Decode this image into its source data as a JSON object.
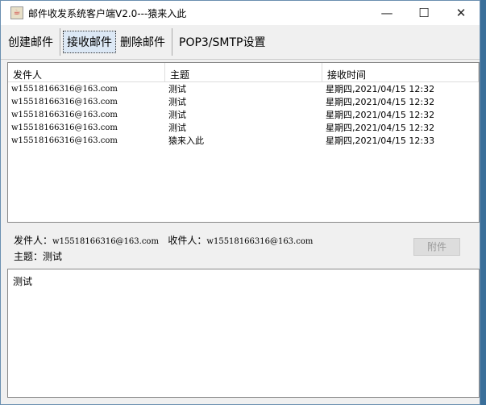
{
  "window": {
    "title": "邮件收发系统客户端V2.0---猿来入此",
    "minimize": "—",
    "maximize": "☐",
    "close": "✕"
  },
  "toolbar": [
    "创建邮件",
    "接收邮件",
    "删除邮件",
    "POP3/SMTP设置"
  ],
  "table": {
    "headers": [
      "发件人",
      "主题",
      "接收时间"
    ],
    "rows": [
      [
        "w15518166316@163.com",
        "测试",
        "星期四,2021/04/15 12:32"
      ],
      [
        "w15518166316@163.com",
        "测试",
        "星期四,2021/04/15 12:32"
      ],
      [
        "w15518166316@163.com",
        "测试",
        "星期四,2021/04/15 12:32"
      ],
      [
        "w15518166316@163.com",
        "测试",
        "星期四,2021/04/15 12:32"
      ],
      [
        "w15518166316@163.com",
        "猿来入此",
        "星期四,2021/04/15 12:33"
      ]
    ]
  },
  "detail": {
    "from_label": "发件人：",
    "from": "w15518166316@163.com",
    "to_label": "收件人：",
    "to": "w15518166316@163.com",
    "subject_label": "主题：",
    "subject": "测试",
    "attachment_button": "附件",
    "body": "测试"
  }
}
